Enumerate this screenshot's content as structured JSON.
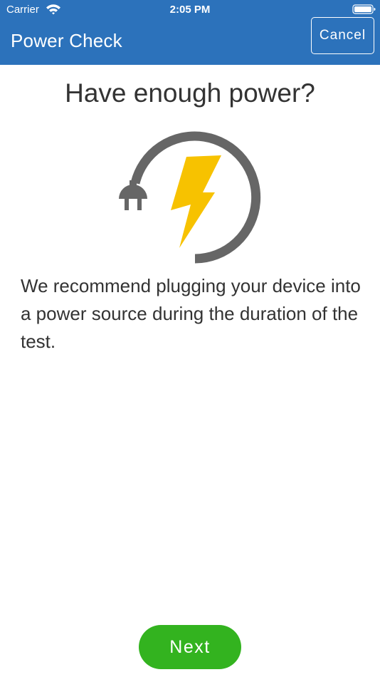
{
  "status_bar": {
    "carrier": "Carrier",
    "time": "2:05 PM",
    "icons": [
      "wifi-icon",
      "battery-icon"
    ]
  },
  "header": {
    "title": "Power Check",
    "cancel_label": "Cancel",
    "background_color": "#2c72bb"
  },
  "main": {
    "heading": "Have enough power?",
    "icon": "plug-lightning-icon",
    "description": "We recommend plugging your device into a power source during the duration of the test."
  },
  "footer": {
    "next_label": "Next",
    "next_color": "#33b31f"
  },
  "colors": {
    "bolt": "#f7c200",
    "plug": "#666666"
  }
}
